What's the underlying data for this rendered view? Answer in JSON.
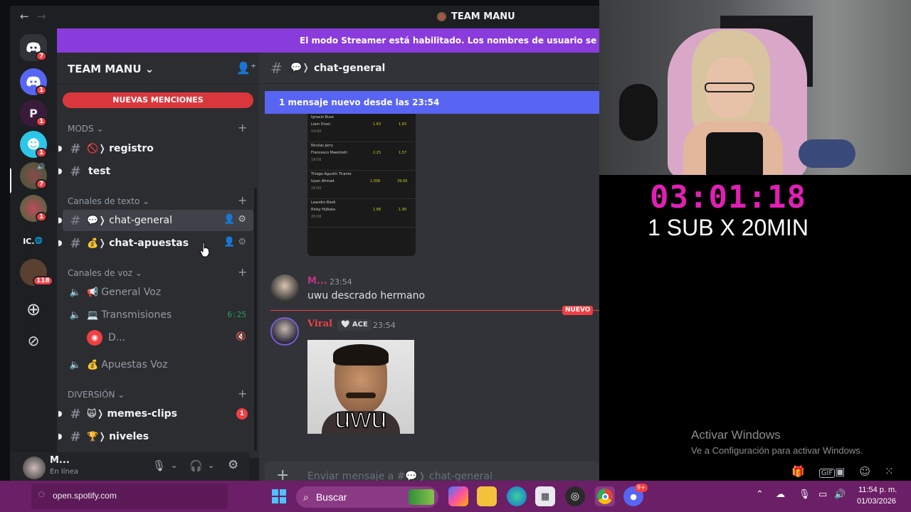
{
  "window": {
    "title": "TEAM MANU",
    "back_glyph": "←",
    "forward_glyph": "→"
  },
  "streamer_banner": "El modo Streamer está habilitado. Los nombres de usuario se han truncado",
  "guilds": [
    {
      "label": "",
      "badge": "7",
      "color": "#313338",
      "icon": "discord-home-icon"
    },
    {
      "label": "",
      "badge": "1",
      "color": "#5865f2",
      "icon": "discord-logo-icon"
    },
    {
      "label": "P",
      "badge": "1",
      "color": "#3a1a3a",
      "icon": "p-server-icon"
    },
    {
      "label": "",
      "badge": "1",
      "color": "#2cc7e8",
      "icon": "smile-server-icon"
    },
    {
      "label": "",
      "badge": "7",
      "color": "#6b3a3a",
      "icon": "team-manu-server-icon"
    },
    {
      "label": "",
      "badge": "1",
      "color": "#7a3344",
      "icon": "server-globe-icon"
    },
    {
      "label": "IC.",
      "badge": "",
      "color": "#1e1f22",
      "icon": "ic-server-icon"
    },
    {
      "label": "",
      "badge": "118",
      "color": "#5a4030",
      "icon": "folder-server-icon"
    }
  ],
  "sidebar": {
    "server_name": "TEAM MANU ⌄",
    "mentions_label": "NUEVAS MENCIONES",
    "categories": {
      "mods": "MODS ⌄",
      "text": "Canales de texto ⌄",
      "voice": "Canales de voz ⌄",
      "fun": "DIVERSIÓN ⌄"
    },
    "channels": {
      "registro": {
        "emoji": "🚫❭",
        "name": "registro"
      },
      "test": {
        "name": "test"
      },
      "chat_general": {
        "emoji": "💬❭",
        "name": "chat-general"
      },
      "chat_apuestas": {
        "emoji": "💰❭",
        "name": "chat-apuestas"
      },
      "general_voz": {
        "emoji": "📢",
        "name": "General Voz"
      },
      "transmisiones": {
        "emoji": "💻",
        "name": "Transmisiones",
        "time": "6:25"
      },
      "voice_user": "D...",
      "apuestas_voz": {
        "emoji": "💰",
        "name": "Apuestas Voz"
      },
      "memes": {
        "emoji": "🙀❭",
        "name": "memes-clips",
        "badge": "1"
      },
      "niveles": {
        "emoji": "🏆❭",
        "name": "niveles"
      }
    }
  },
  "user_panel": {
    "name": "M...",
    "status": "En línea"
  },
  "chat": {
    "header_emoji": "💬❭",
    "header_name": "chat-general",
    "new_messages": "1 mensaje nuevo desde las 23:54",
    "odds_rows": [
      {
        "p1": "Ignacio Buse",
        "p2": "Liam Draxl",
        "t": "14:00",
        "o1": "1.83",
        "o2": "1.83"
      },
      {
        "p1": "Nicolas Jarry",
        "p2": "Francesco Maestrelli",
        "t": "19:00",
        "o1": "2.25",
        "o2": "1.57"
      },
      {
        "p1": "Thiago Agustín Tirante",
        "p2": "Izyan Ahmad",
        "t": "19:00",
        "o1": "1.006",
        "o2": "29.00"
      },
      {
        "p1": "Leandro Riedi",
        "p2": "Rinky Hijikata",
        "t": "20:00",
        "o1": "1.88",
        "o2": "1.90"
      }
    ],
    "messages": [
      {
        "author": "M...",
        "time": "23:54",
        "text": "uwu descrado hermano",
        "author_color": "#c13584"
      },
      {
        "author": "Viral",
        "tag": "🤍 ACE",
        "time": "23:54",
        "image_caption": "uwu",
        "author_color": "#f23f43"
      }
    ],
    "new_label": "NUEVO",
    "composer_placeholder": "Enviar mensaje a #💬❭ chat-general"
  },
  "overlay": {
    "timer": "03:01:18",
    "subs": "1 SUB X 20MIN",
    "activate_title": "Activar Windows",
    "activate_sub": "Ve a Configuración para activar Windows."
  },
  "taskbar": {
    "spotify": "open.spotify.com",
    "search": "Buscar",
    "time": "11:54 p. m.",
    "date": "01/03/2026",
    "discord_badge": "9+"
  }
}
